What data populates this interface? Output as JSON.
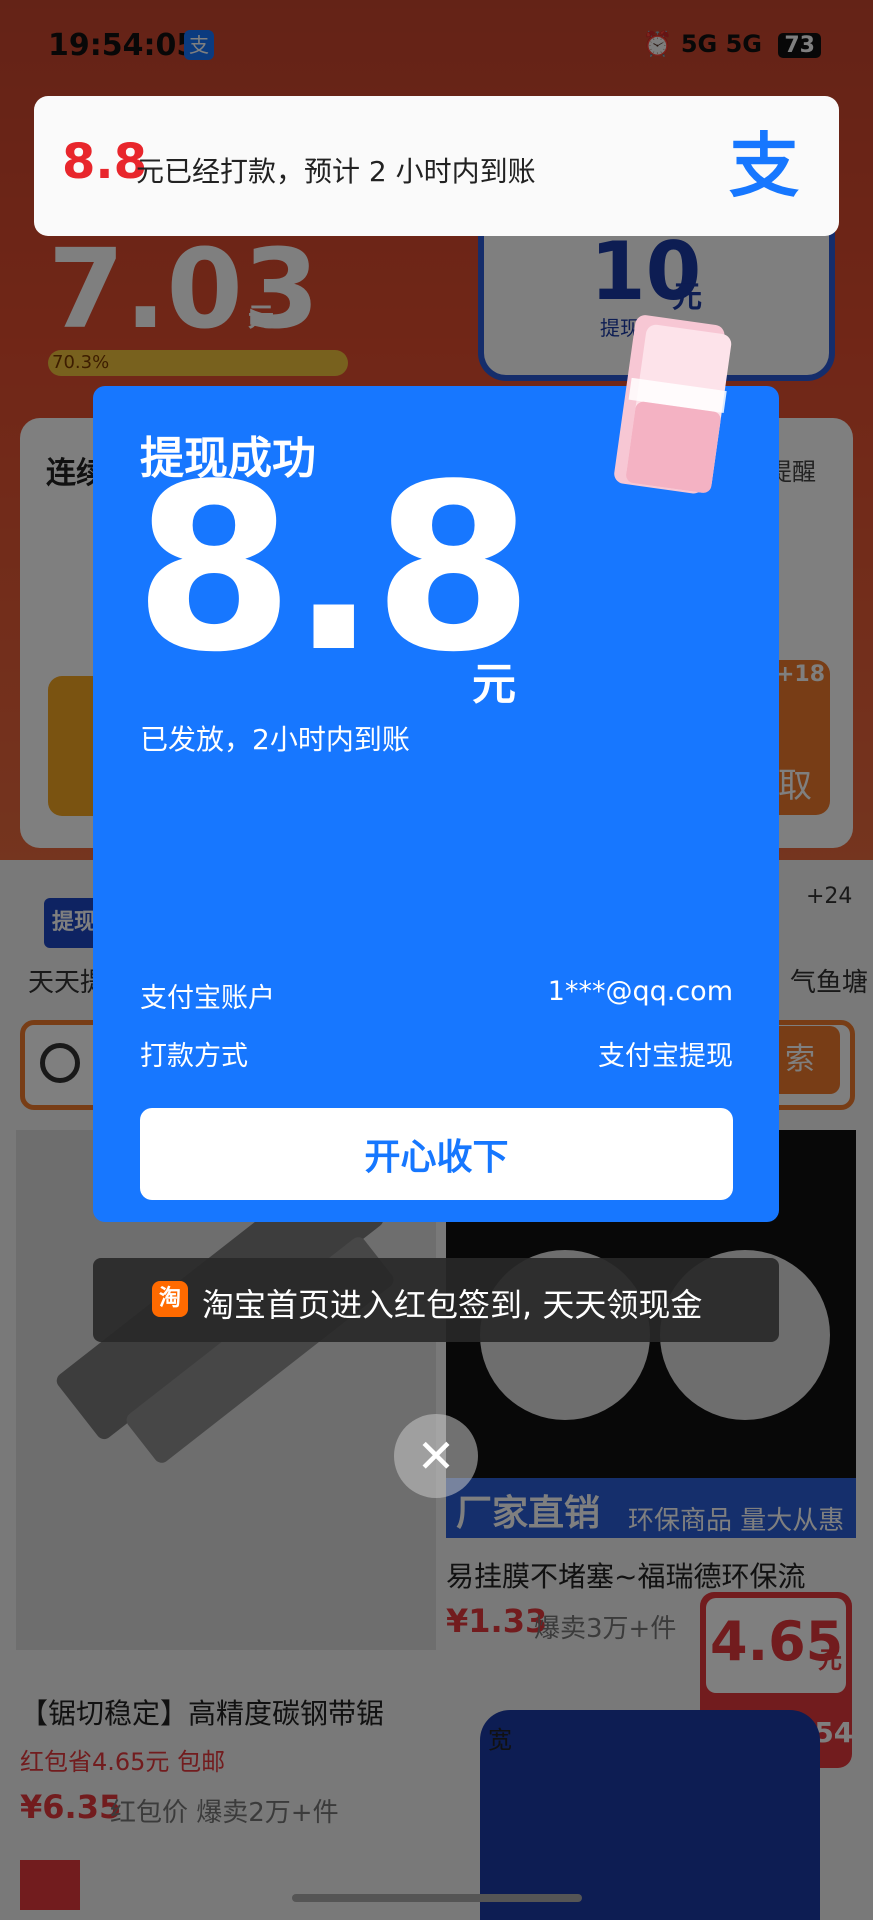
{
  "status_bar": {
    "time": "19:54:05",
    "signal1": "5G",
    "signal2": "5G",
    "battery": "73"
  },
  "background": {
    "balance": "7.03",
    "balance_unit": "元",
    "progress": "70.3%",
    "coupon_value": "10",
    "coupon_unit": "元",
    "coupon_sub": "提现",
    "task_title": "连续",
    "task_remind": "提醒",
    "task_right_badge": "+18",
    "task_right_text": "取",
    "mini_left_label": "天天提",
    "mini_left_badge": "提现",
    "mini_right_label": "气鱼塘",
    "mini_right_badge": "+24",
    "search_button": "索",
    "products": [
      {
        "title": "【锯切稳定】高精度碳钢带锯",
        "coupon": "红包省4.65元 包邮",
        "price": "¥6.35",
        "price_label": "红包价 爆卖2万+件"
      },
      {
        "title": "易挂膜不堵塞~福瑞德环保流",
        "price": "¥1.33",
        "sold": "爆卖3万+件",
        "banner": "厂家直销",
        "banner_sub": "环保商品 量大从惠"
      }
    ],
    "timer_value": "4.65",
    "timer_unit": "元",
    "timer_clock": "04:05:54",
    "tent_label": "宽"
  },
  "notification": {
    "amount": "8.8",
    "text": "元已经打款，预计 2 小时内到账",
    "logo_icon": "alipay-logo"
  },
  "modal": {
    "title": "提现成功",
    "amount": "8.8",
    "unit": "元",
    "subtitle": "已发放，2小时内到账",
    "account_label": "支付宝账户",
    "account_value": "1***@qq.com",
    "method_label": "打款方式",
    "method_value": "支付宝提现",
    "button_label": "开心收下"
  },
  "promo": {
    "icon": "淘",
    "text": "淘宝首页进入红包签到, 天天领现金"
  },
  "close_icon": "close-icon",
  "colors": {
    "primary": "#1777ff",
    "accent_red": "#e8262c",
    "orange": "#f07b2c"
  }
}
